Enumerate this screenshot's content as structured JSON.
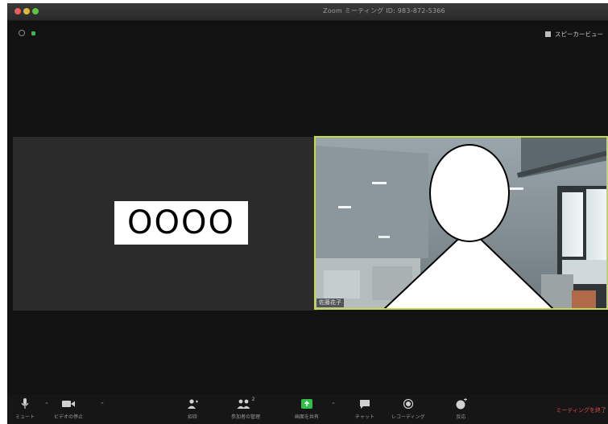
{
  "window": {
    "title": "Zoom ミーティング ID: 983-872-5366"
  },
  "top": {
    "speaker_view_label": "スピーカービュー"
  },
  "participants": [
    {
      "card_text": "OOOO"
    },
    {
      "name_tag": "佐藤花子"
    }
  ],
  "toolbar": {
    "mute_label": "ミュート",
    "video_label": "ビデオの停止",
    "invite_label": "招待",
    "participants_label": "参加者の管理",
    "participants_count": "2",
    "share_label": "画面を共有",
    "chat_label": "チャット",
    "record_label": "レコーディング",
    "reactions_label": "反応",
    "end_label": "ミーティングを終了"
  },
  "colors": {
    "active_speaker_border": "#c6d84a",
    "share_green": "#2fbf4a",
    "end_red": "#d64a4a"
  }
}
